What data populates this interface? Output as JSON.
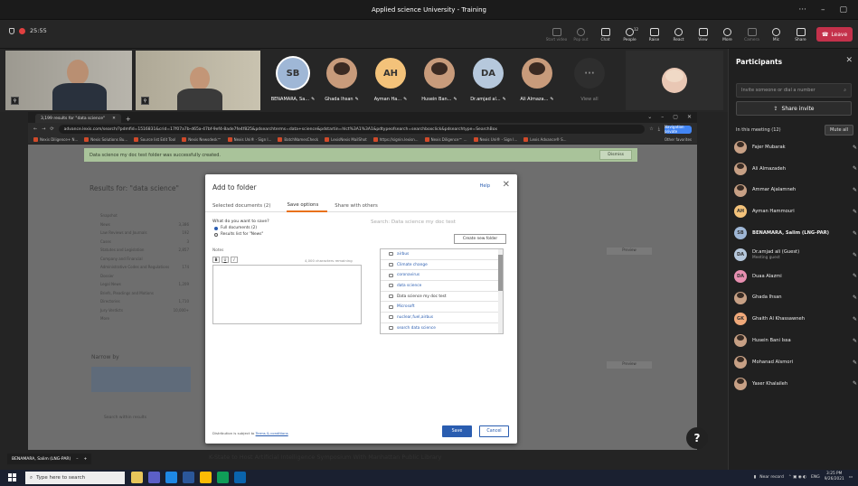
{
  "window": {
    "title": "Applied science University - Training"
  },
  "meeting": {
    "timer": "25:55",
    "toolbar": [
      {
        "label": "Start video",
        "icon": "video-icon",
        "dim": true
      },
      {
        "label": "Pop out",
        "icon": "popout-icon",
        "dim": true
      },
      {
        "label": "Chat",
        "icon": "chat-icon",
        "dim": false
      },
      {
        "label": "People",
        "icon": "people-icon",
        "dim": false,
        "count": "12"
      },
      {
        "label": "Raise",
        "icon": "hand-icon",
        "dim": false
      },
      {
        "label": "React",
        "icon": "react-icon",
        "dim": false
      },
      {
        "label": "View",
        "icon": "view-icon",
        "dim": false
      },
      {
        "label": "More",
        "icon": "more-icon",
        "dim": false
      },
      {
        "label": "Camera",
        "icon": "camera-icon",
        "dim": true
      },
      {
        "label": "Mic",
        "icon": "mic-icon",
        "dim": false
      },
      {
        "label": "Share",
        "icon": "share-icon",
        "dim": false
      }
    ],
    "leave_label": "Leave",
    "tiles": [
      {
        "initials": "SB",
        "name": "BENAMARA, Sa...",
        "bg": "#9fb7d6",
        "ring": true
      },
      {
        "initials": "",
        "name": "Ghada Ihsan",
        "bg": "#c89b7b",
        "photo": true
      },
      {
        "initials": "AH",
        "name": "Ayman Ha...",
        "bg": "#f3c27a"
      },
      {
        "initials": "",
        "name": "Husein Ban...",
        "bg": "#c89b7b",
        "photo": true
      },
      {
        "initials": "DA",
        "name": "Dr.amjad al...",
        "bg": "#b6c8dc"
      },
      {
        "initials": "",
        "name": "Ali Almaza...",
        "bg": "#c89b7b",
        "photo": true
      }
    ],
    "more_tile": {
      "label": "View all"
    }
  },
  "participants": {
    "title": "Participants",
    "invite_placeholder": "Invite someone or dial a number",
    "share_invite": "Share invite",
    "in_meeting": "In this meeting (12)",
    "mute_all": "Mute all",
    "people": [
      {
        "name": "Fajer Mubarak",
        "initials": "",
        "photo": true,
        "sub": ""
      },
      {
        "name": "Ali Almazadeh",
        "initials": "",
        "photo": true,
        "sub": ""
      },
      {
        "name": "Ammar Ajalamneh",
        "initials": "",
        "photo": true,
        "sub": ""
      },
      {
        "name": "Ayman Hammouri",
        "initials": "AH",
        "bg": "#f3c27a",
        "sub": ""
      },
      {
        "name": "BENAMARA, Salim (LNG-PAR)",
        "initials": "SB",
        "bg": "#9fb7d6",
        "sub": "",
        "bold": true
      },
      {
        "name": "Dr.amjad ali (Guest)",
        "initials": "DA",
        "bg": "#b6c8dc",
        "sub": "Meeting guest"
      },
      {
        "name": "Duaa Alazmi",
        "initials": "DA",
        "bg": "#e88fb0",
        "sub": ""
      },
      {
        "name": "Ghada Ihsan",
        "initials": "",
        "photo": true,
        "sub": ""
      },
      {
        "name": "Ghaith Al Khassawneh",
        "initials": "GK",
        "bg": "#f0a97a",
        "sub": ""
      },
      {
        "name": "Husein Bani Issa",
        "initials": "",
        "photo": true,
        "sub": ""
      },
      {
        "name": "Mohanad Alsmori",
        "initials": "",
        "photo": true,
        "sub": ""
      },
      {
        "name": "Yaser Khalaileh",
        "initials": "",
        "photo": true,
        "sub": ""
      }
    ]
  },
  "browser": {
    "tab": "3,199 results for \"data science\"",
    "url": "advance.lexis.com/search/?pdmfid=1516831&crid=17f07a7b-d65a-47bf-9ef4-8ade7fe4f825&pdsearchterms=data+science&pdstartin=hlct%3A1%3A1&pdtypeofsearch=searchboxclick&pdsearchtype=SearchBox",
    "navigator": "Navigation private",
    "bookmarks": [
      "Nexis Diligence+ N...",
      "Nexis Solutions Bu...",
      "Source list Edit Tool",
      "Nexis Newsdesk™",
      "Nexis Uni® - Sign I...",
      "BatchNamesCheck",
      "LexisNexis MailShot",
      "https://signin.lexisn...",
      "Nexis Diligence™ ...",
      "Nexis Uni® - Sign I...",
      "Lexis Advance® S..."
    ],
    "other_bookmarks": "Other favorites"
  },
  "page": {
    "banner": "Data science my doc test folder was successfully created.",
    "dismiss": "Dismiss",
    "results_title": "Results for: \"data science\"",
    "filters": [
      "Snapshot",
      "News",
      "Law Reviews and Journals",
      "Cases",
      "Statutes and Legislation",
      "Company and Financial",
      "Administrative Codes and Regulations",
      "Dossier",
      "Legal News",
      "Briefs, Pleadings and Motions",
      "Directories",
      "Jury Verdicts",
      "More"
    ],
    "counts": [
      "",
      "3,386",
      "192",
      "3",
      "2,857",
      "",
      "174",
      "",
      "1,209",
      "",
      "1,710",
      "10,000+",
      ""
    ],
    "narrow_by": "Narrow by",
    "search_within": "Search within results",
    "article_title": "K-State to Host Artificial Intelligence Symposium With Manhattan Public Library",
    "chat_name": "BENAMARA, Salim (LNG-PAR)",
    "preview": "Preview",
    "help": "?"
  },
  "dialog": {
    "title": "Add to folder",
    "help": "Help",
    "tabs": [
      {
        "label": "Selected documents (2)",
        "active": false
      },
      {
        "label": "Save options",
        "active": true
      },
      {
        "label": "Share with others",
        "active": false
      }
    ],
    "question": "What do you want to save?",
    "options": [
      {
        "label": "Full documents (2)",
        "checked": true
      },
      {
        "label": "Results list for \"News\"",
        "checked": false
      }
    ],
    "notes_label": "Notes",
    "char_count": "4,000 characters remaining",
    "editor_buttons": [
      "B",
      "U",
      "I"
    ],
    "folder_search": "Search: Data science my doc test",
    "new_folder": "Create new folder",
    "folders": [
      "airbus",
      "Climate change",
      "coronavirus",
      "data science",
      "Data science my doc test",
      "Microsoft",
      "nuclear,fuel,airbus",
      "search data science"
    ],
    "selected_folder": "Data science my doc test",
    "terms_prefix": "Distribution is subject to",
    "terms_link": "Terms & conditions",
    "save": "Save",
    "cancel": "Cancel"
  },
  "taskbar": {
    "search_placeholder": "Type here to search",
    "near_record": "Near record",
    "lang": "ENG",
    "time": "3:25 PM",
    "date": "9/26/2021"
  }
}
